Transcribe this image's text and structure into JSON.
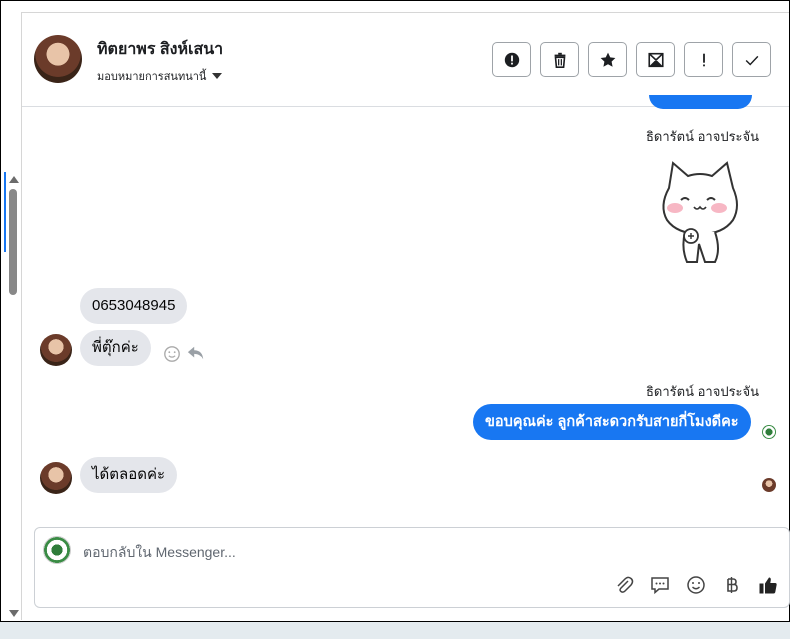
{
  "header": {
    "contact_name": "ทิตยาพร สิงห์เสนา",
    "assign_label": "มอบหมายการสนทนานี้",
    "actions": [
      {
        "name": "spam",
        "icon": "exclamation-circle-icon"
      },
      {
        "name": "delete",
        "icon": "trash-icon"
      },
      {
        "name": "star",
        "icon": "star-icon"
      },
      {
        "name": "mark-unread",
        "icon": "envelope-icon"
      },
      {
        "name": "important",
        "icon": "exclamation-icon"
      },
      {
        "name": "done",
        "icon": "check-icon"
      }
    ]
  },
  "messages": [
    {
      "sender": "ธิดารัตน์ อาจประจัน",
      "type": "sticker",
      "direction": "out",
      "sticker": "cat-sticker"
    },
    {
      "type": "text",
      "direction": "in",
      "text": "0653048945"
    },
    {
      "type": "text",
      "direction": "in",
      "text": "พี่ตุ๊กค่ะ"
    },
    {
      "sender": "ธิดารัตน์ อาจประจัน",
      "type": "text",
      "direction": "out",
      "text": "ขอบคุณค่ะ ลูกค้าสะดวกรับสายกี่โมงดีคะ"
    },
    {
      "type": "text",
      "direction": "in",
      "text": "ได้ตลอดค่ะ"
    }
  ],
  "composer": {
    "placeholder": "ตอบกลับใน Messenger...",
    "tools": [
      "paperclip-icon",
      "speech-bubble-icon",
      "smiley-icon",
      "baht-icon",
      "thumbs-up-icon"
    ]
  },
  "colors": {
    "accent": "#1877f2",
    "bubble_in": "#e4e6eb",
    "text": "#050505"
  }
}
